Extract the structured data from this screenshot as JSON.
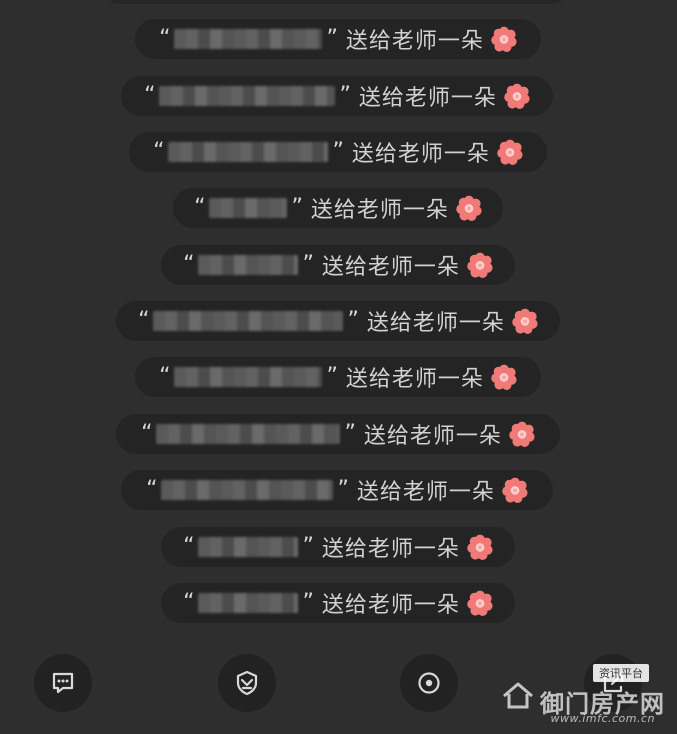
{
  "messages": {
    "quote_open": "“",
    "quote_close": "”",
    "suffix": "送给老师一朵",
    "flower_icon": "flower-icon",
    "rows": [
      {
        "text": "送给老师一朵"
      },
      {
        "text": "送给老师一朵"
      },
      {
        "text": "送给老师一朵"
      },
      {
        "text": "送给老师一朵"
      },
      {
        "text": "送给老师一朵"
      },
      {
        "text": "送给老师一朵"
      },
      {
        "text": "送给老师一朵"
      },
      {
        "text": "送给老师一朵"
      },
      {
        "text": "送给老师一朵"
      },
      {
        "text": "送给老师一朵"
      },
      {
        "text": "送给老师一朵"
      }
    ]
  },
  "toolbar": {
    "buttons": [
      {
        "icon": "comment-icon"
      },
      {
        "icon": "shield-icon"
      },
      {
        "icon": "target-icon"
      },
      {
        "icon": "share-icon"
      }
    ]
  },
  "watermark": {
    "tag": "资讯平台",
    "main": "御门房产网",
    "domain": "www.imfc.com.cn"
  },
  "colors": {
    "background": "#2e2e2e",
    "pill": "#242424",
    "text": "#d2d2d2",
    "flower_petal": "#f07a78",
    "flower_center": "#ffd0ce"
  }
}
